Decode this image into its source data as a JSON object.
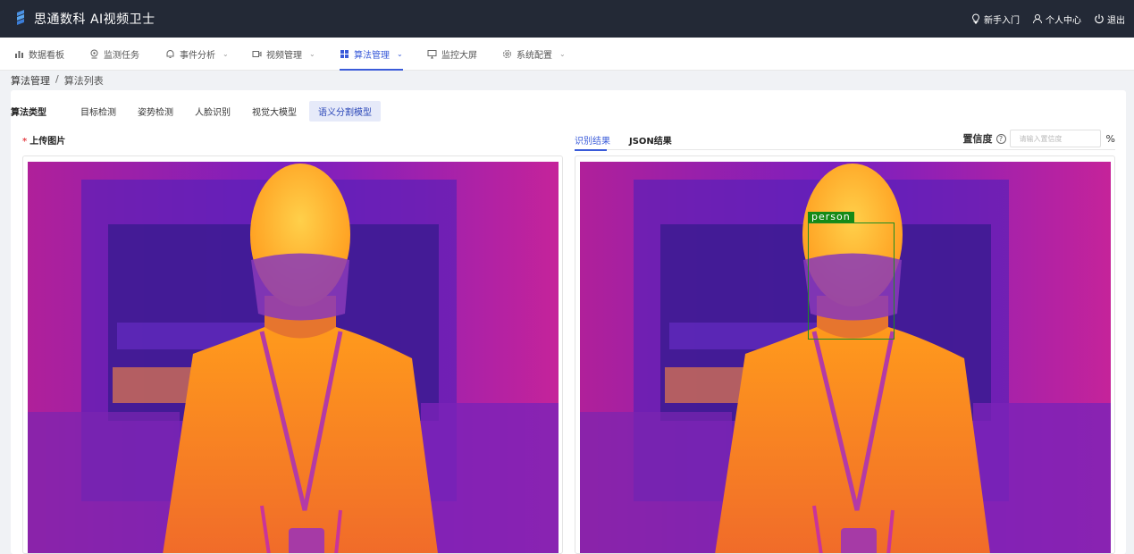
{
  "app": {
    "title": "思通数科 AI视频卫士",
    "actions": [
      {
        "label": "新手入门",
        "icon": "bulb-icon"
      },
      {
        "label": "个人中心",
        "icon": "user-icon"
      },
      {
        "label": "退出",
        "icon": "power-icon"
      }
    ]
  },
  "nav": {
    "items": [
      {
        "label": "数据看板",
        "icon": "bar-chart-icon",
        "has_dropdown": false
      },
      {
        "label": "监测任务",
        "icon": "camera-icon",
        "has_dropdown": false
      },
      {
        "label": "事件分析",
        "icon": "bell-icon",
        "has_dropdown": true
      },
      {
        "label": "视频管理",
        "icon": "video-icon",
        "has_dropdown": true
      },
      {
        "label": "算法管理",
        "icon": "grid-icon",
        "has_dropdown": true,
        "active": true
      },
      {
        "label": "监控大屏",
        "icon": "monitor-icon",
        "has_dropdown": false
      },
      {
        "label": "系统配置",
        "icon": "gear-icon",
        "has_dropdown": true
      }
    ],
    "chevron": "⌄"
  },
  "breadcrumb": {
    "root": "算法管理",
    "separator": "/",
    "current": "算法列表"
  },
  "algo_types": {
    "label": "算法类型",
    "tabs": [
      "目标检测",
      "姿势检测",
      "人脸识别",
      "视觉大模型",
      "语义分割模型"
    ],
    "active_index": 4
  },
  "upload": {
    "required_mark": "*",
    "label": "上传图片"
  },
  "result": {
    "tabs": [
      "识别结果",
      "JSON结果"
    ],
    "active_index": 0,
    "confidence_label": "置信度",
    "confidence_help": "?",
    "confidence_placeholder": "请输入置信度",
    "confidence_unit": "%",
    "detection_label": "person",
    "detection_color": "#158a17"
  },
  "colors": {
    "accent": "#3a5bd9",
    "topbar": "#232936",
    "active_tab_bg": "#e6eaf9"
  }
}
